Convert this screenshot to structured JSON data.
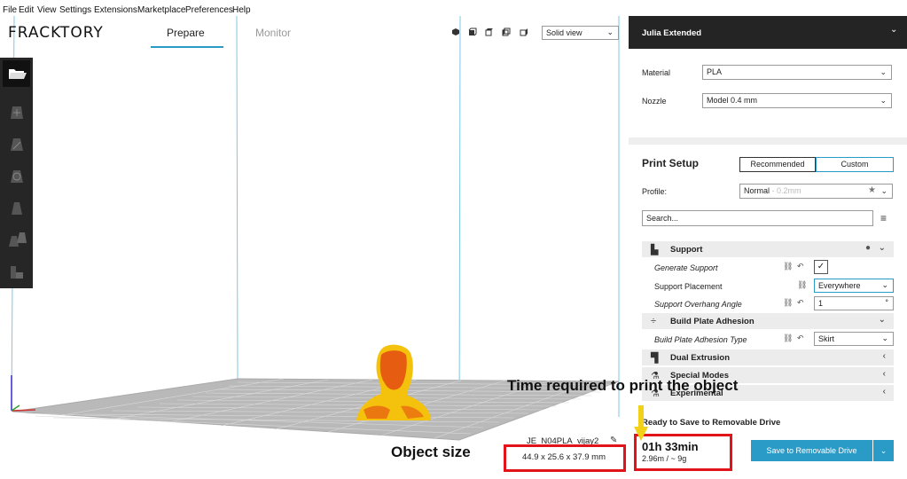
{
  "menu": [
    "File",
    "Edit",
    "View",
    "Settings",
    "Extensions",
    "Marketplace",
    "Preferences",
    "Help"
  ],
  "header": {
    "logo": "FRACKTORY",
    "tabs": [
      {
        "label": "Prepare",
        "active": true
      },
      {
        "label": "Monitor",
        "active": false
      }
    ],
    "view_mode": "Solid view",
    "view_icons": [
      "3d-view-icon",
      "front-view-icon",
      "top-view-icon",
      "left-view-icon",
      "right-view-icon"
    ]
  },
  "left_toolbar": [
    "open-file-icon",
    "move-tool-icon",
    "scale-tool-icon",
    "rotate-tool-icon",
    "mirror-tool-icon",
    "per-model-settings-icon",
    "support-blocker-icon"
  ],
  "printer_panel": {
    "printer": "Julia Extended",
    "material_label": "Material",
    "material_value": "PLA",
    "nozzle_label": "Nozzle",
    "nozzle_value": "Model 0.4 mm"
  },
  "print_setup": {
    "title": "Print Setup",
    "recommended_label": "Recommended",
    "custom_label": "Custom",
    "profile_label": "Profile:",
    "profile_value": "Normal",
    "profile_hint": "- 0.2mm",
    "search_placeholder": "Search..."
  },
  "settings": {
    "support": "Support",
    "generate_support": "Generate Support",
    "generate_support_checked": true,
    "support_placement": "Support Placement",
    "support_placement_value": "Everywhere",
    "support_overhang_angle": "Support Overhang Angle",
    "support_overhang_value": "1",
    "support_overhang_unit": "°",
    "build_plate_adhesion": "Build Plate Adhesion",
    "build_plate_adhesion_type": "Build Plate Adhesion Type",
    "build_plate_adhesion_value": "Skirt",
    "dual_extrusion": "Dual Extrusion",
    "special_modes": "Special Modes",
    "experimental": "Experimental"
  },
  "status": {
    "ready": "Ready to Save to Removable Drive",
    "object_name": "JE_N04PLA_vijay2",
    "object_size": "44.9 x 25.6 x 37.9 mm",
    "print_time": "01h 33min",
    "material_usage": "2.96m / ~ 9g",
    "save_button": "Save to Removable Drive"
  },
  "annotations": {
    "time_required": "Time required to print the object",
    "object_size_label": "Object size"
  },
  "colors": {
    "accent": "#2a9ac7",
    "annotation": "#e3131a",
    "arrow": "#f2d218",
    "model": "#f4c20d"
  }
}
